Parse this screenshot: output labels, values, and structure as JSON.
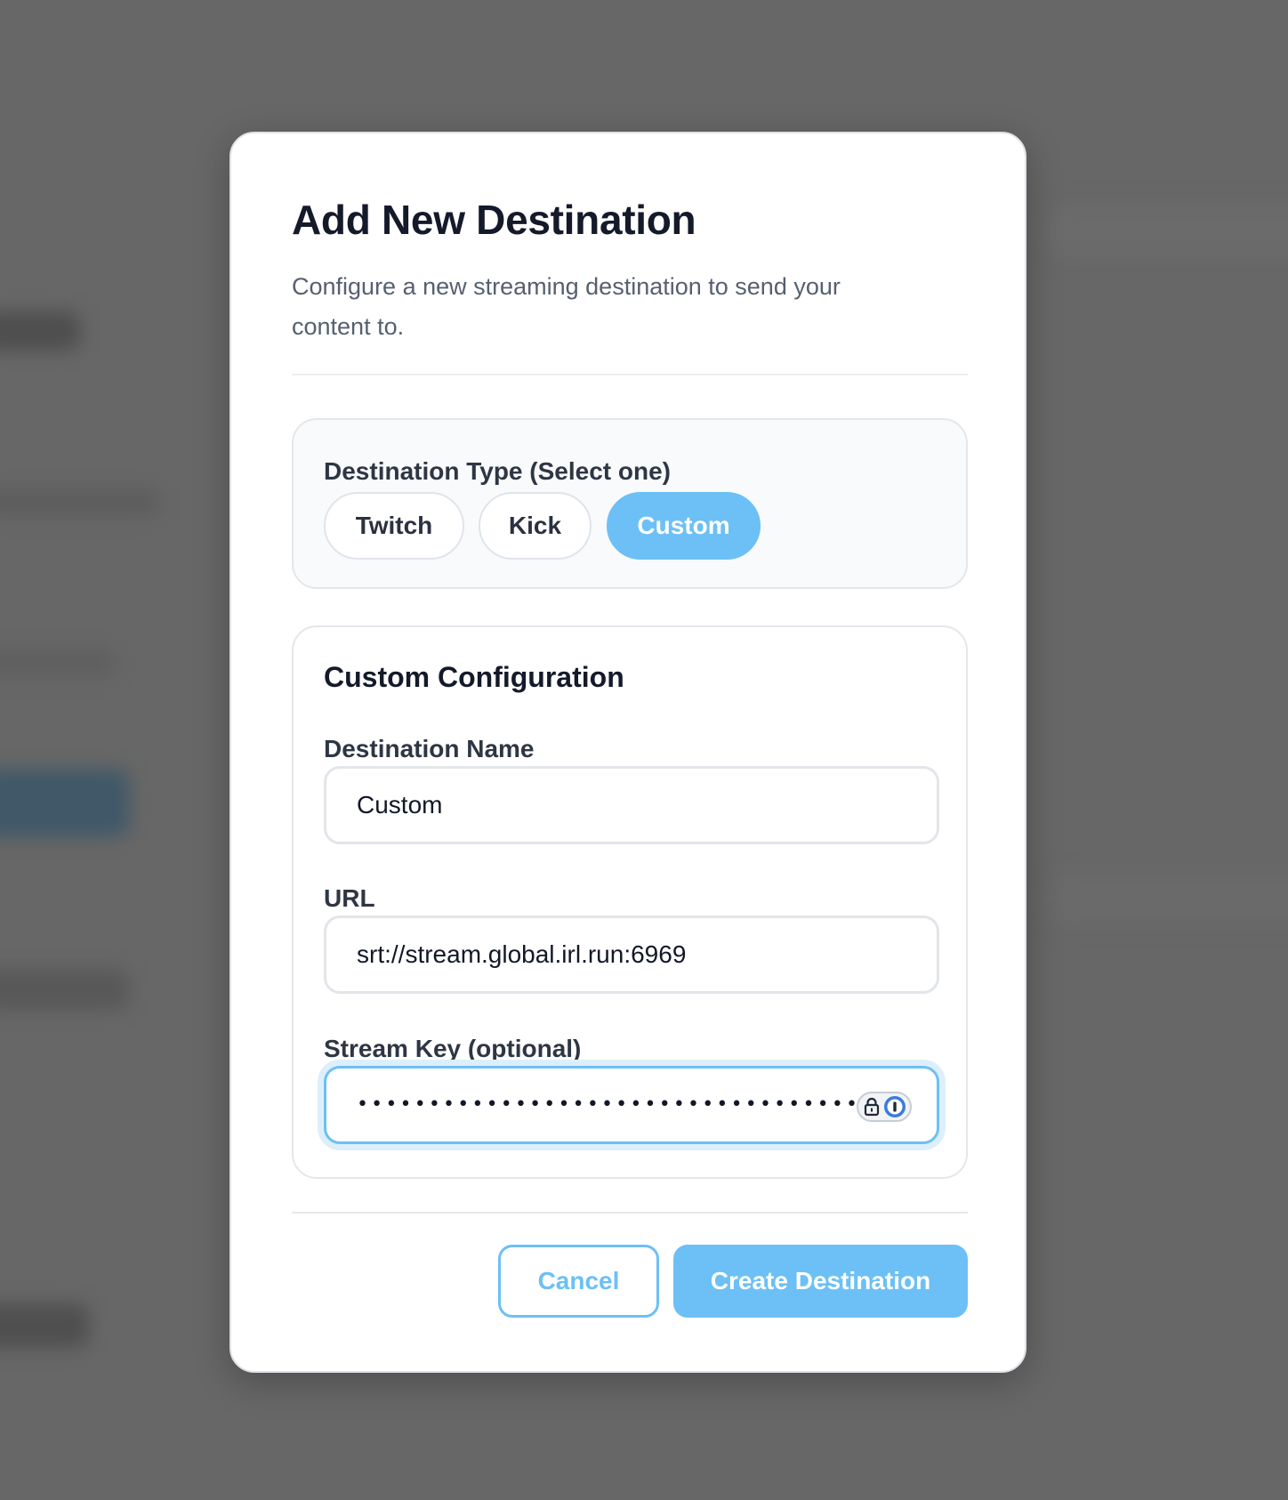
{
  "modal": {
    "title": "Add New Destination",
    "subtitle": "Configure a new streaming destination to send your content to."
  },
  "destination_type": {
    "label": "Destination Type (Select one)",
    "options": [
      "Twitch",
      "Kick",
      "Custom"
    ],
    "selected": "Custom"
  },
  "config": {
    "title": "Custom Configuration",
    "name_label": "Destination Name",
    "name_value": "Custom",
    "url_label": "URL",
    "url_value": "srt://stream.global.irl.run:6969",
    "key_label": "Stream Key (optional)",
    "key_masked": "••••••••••••••••••••••••••••••••••••••",
    "key_icons": [
      "lock-icon",
      "password-manager-icon"
    ]
  },
  "footer": {
    "cancel_label": "Cancel",
    "create_label": "Create Destination"
  },
  "colors": {
    "accent": "#6cc0f5",
    "title": "#141a2a",
    "muted": "#556070",
    "overlay": "#676767"
  }
}
